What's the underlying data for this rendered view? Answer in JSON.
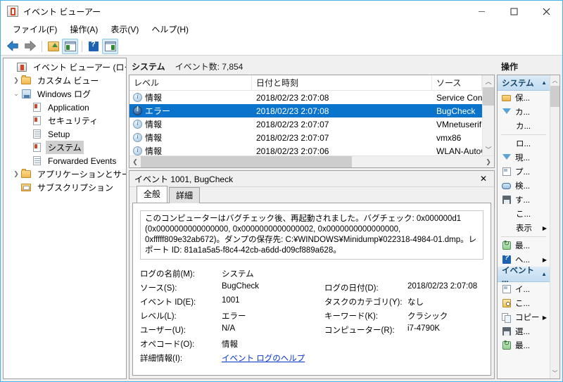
{
  "window": {
    "title": "イベント ビューアー",
    "minimize_label": "最小化",
    "maximize_label": "最大化",
    "close_label": "閉じる"
  },
  "menu": [
    {
      "label": "ファイル(F)"
    },
    {
      "label": "操作(A)"
    },
    {
      "label": "表示(V)"
    },
    {
      "label": "ヘルプ(H)"
    }
  ],
  "toolbar": [
    {
      "name": "back",
      "icon": "back-arrow-icon"
    },
    {
      "name": "forward",
      "icon": "forward-arrow-icon"
    },
    {
      "name": "up-one-level",
      "icon": "folder-up-icon"
    },
    {
      "name": "show-tree-pane",
      "icon": "panel-left-icon",
      "active": true
    },
    {
      "name": "help",
      "icon": "help-icon"
    },
    {
      "name": "show-action-pane",
      "icon": "panel-right-icon",
      "active": true
    }
  ],
  "tree": [
    {
      "label": "イベント ビューアー (ローカル)",
      "icon": "console-root-icon",
      "depth": 0,
      "expander": "",
      "selected": false
    },
    {
      "label": "カスタム ビュー",
      "icon": "folder-icon",
      "depth": 1,
      "expander": "collapsed",
      "selected": false
    },
    {
      "label": "Windows ログ",
      "icon": "log-folder-icon",
      "depth": 1,
      "expander": "expanded",
      "selected": false
    },
    {
      "label": "Application",
      "icon": "event-log-icon",
      "depth": 2,
      "expander": "",
      "selected": false
    },
    {
      "label": "セキュリティ",
      "icon": "event-log-icon",
      "depth": 2,
      "expander": "",
      "selected": false
    },
    {
      "label": "Setup",
      "icon": "event-log-plain-icon",
      "depth": 2,
      "expander": "",
      "selected": false
    },
    {
      "label": "システム",
      "icon": "event-log-icon",
      "depth": 2,
      "expander": "",
      "selected": true
    },
    {
      "label": "Forwarded Events",
      "icon": "event-log-plain-icon",
      "depth": 2,
      "expander": "",
      "selected": false
    },
    {
      "label": "アプリケーションとサービス ログ",
      "icon": "folder-icon",
      "depth": 1,
      "expander": "collapsed",
      "selected": false
    },
    {
      "label": "サブスクリプション",
      "icon": "subscription-icon",
      "depth": 1,
      "expander": "",
      "selected": false
    }
  ],
  "list": {
    "title": "システム",
    "count_label": "イベント数: 7,854",
    "columns": [
      "レベル",
      "日付と時刻",
      "ソース"
    ],
    "rows": [
      {
        "level": "情報",
        "level_icon": "information-icon",
        "datetime": "2018/02/23 2:07:08",
        "source": "Service Contro",
        "selected": false
      },
      {
        "level": "エラー",
        "level_icon": "error-icon",
        "datetime": "2018/02/23 2:07:08",
        "source": "BugCheck",
        "selected": true
      },
      {
        "level": "情報",
        "level_icon": "information-icon",
        "datetime": "2018/02/23 2:07:07",
        "source": "VMnetuserif",
        "selected": false
      },
      {
        "level": "情報",
        "level_icon": "information-icon",
        "datetime": "2018/02/23 2:07:07",
        "source": "vmx86",
        "selected": false
      },
      {
        "level": "情報",
        "level_icon": "information-icon",
        "datetime": "2018/02/23 2:07:06",
        "source": "WLAN-AutoC",
        "selected": false
      }
    ]
  },
  "detail": {
    "header": "イベント 1001, BugCheck",
    "close_label": "✕",
    "tabs": [
      {
        "label": "全般",
        "active": true
      },
      {
        "label": "詳細",
        "active": false
      }
    ],
    "description": "このコンピューターはバグチェック後、再起動されました。バグチェック: 0x000000d1 (0x0000000000000000, 0x0000000000000002, 0x0000000000000000, 0xfffff809e32ab672)。ダンプの保存先: C:¥WINDOWS¥Minidump¥022318-4984-01.dmp。レポート ID: 81a1a5a5-f8c4-42cb-a6dd-d09cf889a628。",
    "fields": [
      {
        "label": "ログの名前(M):",
        "value": "システム",
        "label2": "",
        "value2": ""
      },
      {
        "label": "ソース(S):",
        "value": "BugCheck",
        "label2": "ログの日付(D):",
        "value2": "2018/02/23 2:07:08"
      },
      {
        "label": "イベント ID(E):",
        "value": "1001",
        "label2": "タスクのカテゴリ(Y):",
        "value2": "なし"
      },
      {
        "label": "レベル(L):",
        "value": "エラー",
        "label2": "キーワード(K):",
        "value2": "クラシック"
      },
      {
        "label": "ユーザー(U):",
        "value": "N/A",
        "label2": "コンピューター(R):",
        "value2": "i7-4790K"
      },
      {
        "label": "オペコード(O):",
        "value": "情報",
        "label2": "",
        "value2": ""
      }
    ],
    "more_info_label": "詳細情報(I):",
    "more_info_link": "イベント ログのヘルプ"
  },
  "actions": {
    "title": "操作",
    "items": [
      {
        "type": "group",
        "label": "システム",
        "caret": "▲"
      },
      {
        "type": "item",
        "label": "保...",
        "icon": "open-saved-log-icon"
      },
      {
        "type": "item",
        "label": "カ...",
        "icon": "create-custom-view-icon"
      },
      {
        "type": "item",
        "label": "カ...",
        "icon": ""
      },
      {
        "type": "sep"
      },
      {
        "type": "item",
        "label": "ロ...",
        "icon": ""
      },
      {
        "type": "item",
        "label": "現...",
        "icon": "filter-icon"
      },
      {
        "type": "item",
        "label": "プ...",
        "icon": "properties-icon"
      },
      {
        "type": "item",
        "label": "検...",
        "icon": "find-icon"
      },
      {
        "type": "item",
        "label": "す...",
        "icon": "save-icon"
      },
      {
        "type": "item",
        "label": "こ...",
        "icon": ""
      },
      {
        "type": "item",
        "label": "表示",
        "icon": "",
        "submenu": "▶"
      },
      {
        "type": "sep"
      },
      {
        "type": "item",
        "label": "最...",
        "icon": "refresh-icon"
      },
      {
        "type": "item",
        "label": "ヘ...",
        "icon": "help-icon",
        "submenu": "▶"
      },
      {
        "type": "group",
        "label": "イベント ...",
        "caret": "▲"
      },
      {
        "type": "item",
        "label": "イ...",
        "icon": "event-properties-icon"
      },
      {
        "type": "item",
        "label": "こ...",
        "icon": "attach-task-icon"
      },
      {
        "type": "item",
        "label": "コピー",
        "icon": "copy-icon",
        "submenu": "▶"
      },
      {
        "type": "item",
        "label": "選...",
        "icon": "save-selected-icon"
      },
      {
        "type": "item",
        "label": "最...",
        "icon": "refresh-icon"
      }
    ]
  }
}
